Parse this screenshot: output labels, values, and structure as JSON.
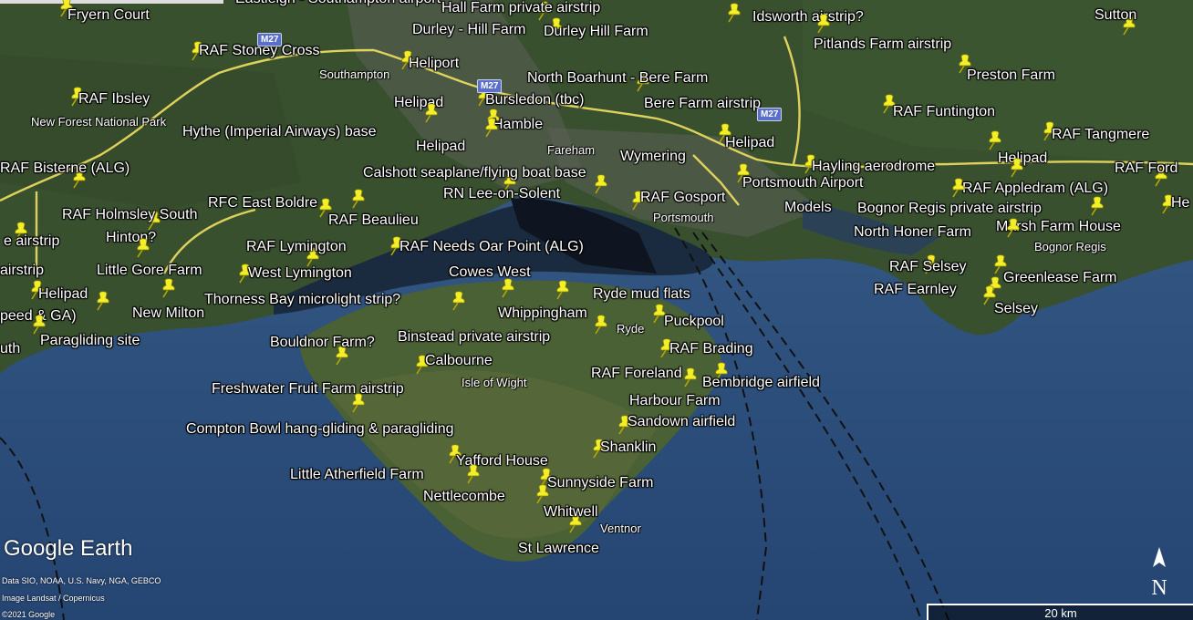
{
  "place_labels": [
    {
      "id": "fryern-court",
      "text": "Fryern Court"
    },
    {
      "id": "rlmp-southampton",
      "text": "Eastleigh - Southampton airport"
    },
    {
      "id": "hall-farm",
      "text": "Hall Farm private airstrip"
    },
    {
      "id": "idsworth",
      "text": "Idsworth airstrip?"
    },
    {
      "id": "sutton",
      "text": "Sutton"
    },
    {
      "id": "durley-hill-farm-a",
      "text": "Durley - Hill Farm"
    },
    {
      "id": "durley-hill-farm-b",
      "text": "Durley Hill Farm"
    },
    {
      "id": "pitlands",
      "text": "Pitlands Farm airstrip"
    },
    {
      "id": "raf-stoney-cross",
      "text": "RAF Stoney Cross"
    },
    {
      "id": "heliport",
      "text": "Heliport"
    },
    {
      "id": "north-boarhunt",
      "text": "North Boarhunt - Bere Farm"
    },
    {
      "id": "preston-farm",
      "text": "Preston Farm"
    },
    {
      "id": "raf-ibsley",
      "text": "RAF Ibsley"
    },
    {
      "id": "helipad-1",
      "text": "Helipad"
    },
    {
      "id": "bursledon",
      "text": "Bursledon (tbc)"
    },
    {
      "id": "bere-farm",
      "text": "Bere Farm airstrip"
    },
    {
      "id": "raf-funtington",
      "text": "RAF Funtington"
    },
    {
      "id": "hamble",
      "text": "Hamble"
    },
    {
      "id": "hythe",
      "text": "Hythe (Imperial Airways) base"
    },
    {
      "id": "raf-tangmere",
      "text": "RAF Tangmere"
    },
    {
      "id": "helipad-2",
      "text": "Helipad"
    },
    {
      "id": "wymering",
      "text": "Wymering"
    },
    {
      "id": "helipad-3",
      "text": "Helipad"
    },
    {
      "id": "helipad-4",
      "text": "Helipad"
    },
    {
      "id": "raf-bisterne",
      "text": "RAF Bisterne (ALG)"
    },
    {
      "id": "calshott",
      "text": "Calshott seaplane/flying boat base"
    },
    {
      "id": "hayling",
      "text": "Hayling aerodrome"
    },
    {
      "id": "raf-ford",
      "text": "RAF Ford"
    },
    {
      "id": "portsmouth-airport",
      "text": "Portsmouth Airport"
    },
    {
      "id": "raf-appledram",
      "text": "RAF Appledram (ALG)"
    },
    {
      "id": "he",
      "text": "He"
    },
    {
      "id": "rn-lee",
      "text": "RN Lee-on-Solent"
    },
    {
      "id": "rfc-east-boldre",
      "text": "RFC East Boldre"
    },
    {
      "id": "raf-gosport",
      "text": "RAF Gosport"
    },
    {
      "id": "models",
      "text": "Models"
    },
    {
      "id": "bognor-regis-strip",
      "text": "Bognor Regis private airstrip"
    },
    {
      "id": "raf-holmsley",
      "text": "RAF Holmsley South"
    },
    {
      "id": "raf-beaulieu",
      "text": "RAF Beaulieu"
    },
    {
      "id": "marsh-farm",
      "text": "Marsh Farm House"
    },
    {
      "id": "hinton",
      "text": "Hinton?"
    },
    {
      "id": "north-honer",
      "text": "North Honer Farm"
    },
    {
      "id": "airstrip-left1",
      "text": "e airstrip"
    },
    {
      "id": "raf-lymington",
      "text": "RAF Lymington"
    },
    {
      "id": "raf-needs-oar",
      "text": "RAF Needs Oar Point (ALG)"
    },
    {
      "id": "raf-selsey",
      "text": "RAF Selsey"
    },
    {
      "id": "airstrip-left2",
      "text": "airstrip"
    },
    {
      "id": "little-gore",
      "text": "Little Gore Farm"
    },
    {
      "id": "west-lymington",
      "text": "West Lymington"
    },
    {
      "id": "cowes-west",
      "text": "Cowes West"
    },
    {
      "id": "greenlease",
      "text": "Greenlease Farm"
    },
    {
      "id": "helipad-5",
      "text": "Helipad"
    },
    {
      "id": "raf-earnley",
      "text": "RAF Earnley"
    },
    {
      "id": "ryde-mud-flats",
      "text": "Ryde mud flats"
    },
    {
      "id": "thorness",
      "text": "Thorness Bay microlight strip?"
    },
    {
      "id": "selsey",
      "text": "Selsey"
    },
    {
      "id": "peed-ga",
      "text": "peed & GA)"
    },
    {
      "id": "new-milton",
      "text": "New Milton"
    },
    {
      "id": "whippingham",
      "text": "Whippingham"
    },
    {
      "id": "puckpool",
      "text": "Puckpool"
    },
    {
      "id": "paragliding-site",
      "text": "Paragliding site"
    },
    {
      "id": "binstead",
      "text": "Binstead private airstrip"
    },
    {
      "id": "bouldnor",
      "text": "Bouldnor Farm?"
    },
    {
      "id": "raf-brading",
      "text": "RAF Brading"
    },
    {
      "id": "calbourne",
      "text": "Calbourne"
    },
    {
      "id": "raf-foreland",
      "text": "RAF Foreland"
    },
    {
      "id": "bembridge",
      "text": "Bembridge airfield"
    },
    {
      "id": "freshwater",
      "text": "Freshwater Fruit Farm airstrip"
    },
    {
      "id": "harbour-farm",
      "text": "Harbour Farm"
    },
    {
      "id": "sandown",
      "text": "Sandown airfield"
    },
    {
      "id": "compton-bowl",
      "text": "Compton Bowl hang-gliding &  paragliding"
    },
    {
      "id": "shanklin",
      "text": "Shanklin"
    },
    {
      "id": "yafford",
      "text": "Yafford House"
    },
    {
      "id": "little-atherfield",
      "text": "Little Atherfield Farm"
    },
    {
      "id": "sunnyside",
      "text": "Sunnyside Farm"
    },
    {
      "id": "nettlecombe",
      "text": "Nettlecombe"
    },
    {
      "id": "whitwell",
      "text": "Whitwell"
    },
    {
      "id": "st-lawrence",
      "text": "St Lawrence"
    },
    {
      "id": "uth",
      "text": "uth"
    }
  ],
  "town_labels": [
    {
      "id": "southampton",
      "text": "Southampton"
    },
    {
      "id": "new-forest",
      "text": "New Forest National Park"
    },
    {
      "id": "fareham",
      "text": "Fareham"
    },
    {
      "id": "portsmouth",
      "text": "Portsmouth"
    },
    {
      "id": "bognor",
      "text": "Bognor Regis"
    },
    {
      "id": "ryde",
      "text": "Ryde"
    },
    {
      "id": "isle-of-wight",
      "text": "Isle of Wight"
    },
    {
      "id": "ventnor",
      "text": "Ventnor"
    }
  ],
  "road_shields": [
    "M27",
    "M27",
    "M27"
  ],
  "branding": {
    "logo": "Google Earth",
    "attribution": [
      "Data SIO, NOAA, U.S. Navy, NGA, GEBCO",
      "Image Landsat / Copernicus",
      "©2021 Google"
    ],
    "scale": "20 km",
    "north": "N"
  },
  "colors": {
    "sea": "#2e4f7a",
    "land": "#3d5233",
    "pin": "#f2ef2a",
    "road": "#f0e060"
  }
}
